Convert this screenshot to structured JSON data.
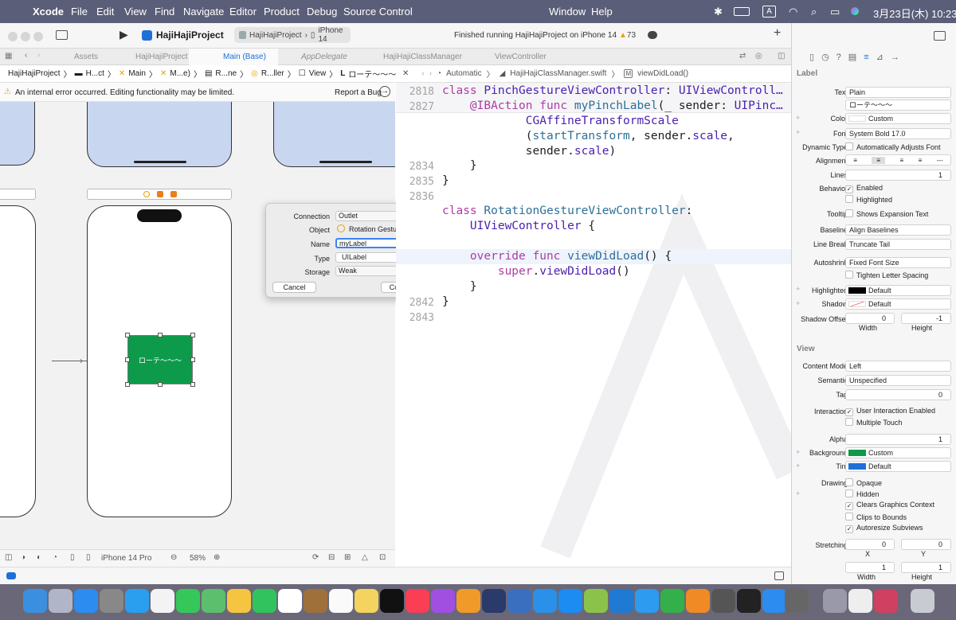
{
  "menubar": {
    "app": "Xcode",
    "items": [
      "File",
      "Edit",
      "View",
      "Find",
      "Navigate",
      "Editor",
      "Product",
      "Debug",
      "Source Control",
      "Window",
      "Help"
    ],
    "input_mode": "A",
    "clock": "3月23日(木)  10:23"
  },
  "toolbar": {
    "project": "HajiHajiProject",
    "scheme": "HajiHajiProject",
    "device": "iPhone 14",
    "status": "Finished running HajiHajiProject on iPhone 14",
    "warnings": "73"
  },
  "tabs": [
    "Assets",
    "HajiHajiProject",
    "Main (Base)",
    "AppDelegate",
    "HajiHajiClassManager",
    "ViewController"
  ],
  "jump_left": [
    "HajiHajiProject",
    "H...ct",
    "Main",
    "M...e)",
    "R...ne",
    "R...ller",
    "View",
    "ローテ〜〜〜"
  ],
  "warning": {
    "text": "An internal error occurred. Editing functionality may be limited.",
    "button": "Report a Bug"
  },
  "jump_right": [
    "Automatic",
    "HajiHajiClassManager.swift",
    "viewDidLoad()"
  ],
  "canvas": {
    "label_text": "ローテ〜〜〜",
    "device": "iPhone 14 Pro",
    "zoom": "58%"
  },
  "code_lines": [
    {
      "num": "2818",
      "text": "class PinchGestureViewController: UIViewControll…"
    },
    {
      "num": "2827",
      "text": "    @IBAction func myPinchLabel(_ sender: UIPinc…"
    },
    {
      "num": "",
      "text": "            CGAffineTransformScale"
    },
    {
      "num": "",
      "text": "            (startTransform, sender.scale,"
    },
    {
      "num": "",
      "text": "            sender.scale)"
    },
    {
      "num": "2834",
      "text": "    }"
    },
    {
      "num": "2835",
      "text": "}"
    },
    {
      "num": "2836",
      "text": ""
    },
    {
      "num": "",
      "text": "class RotationGestureViewController:"
    },
    {
      "num": "",
      "text": "    UIViewController {"
    },
    {
      "num": "",
      "text": ""
    },
    {
      "num": "",
      "text": "    override func viewDidLoad() {"
    },
    {
      "num": "",
      "text": "        super.viewDidLoad()"
    },
    {
      "num": "",
      "text": "    }"
    },
    {
      "num": "2842",
      "text": "}"
    },
    {
      "num": "2843",
      "text": ""
    }
  ],
  "popup": {
    "connection_label": "Connection",
    "connection": "Outlet",
    "object_label": "Object",
    "object": "Rotation Gesture Vie...",
    "name_label": "Name",
    "name": "myLabel",
    "type_label": "Type",
    "type": "UILabel",
    "storage_label": "Storage",
    "storage": "Weak",
    "cancel": "Cancel",
    "connect": "Connect"
  },
  "inspector": {
    "label_section": "Label",
    "text_label": "Text",
    "text_value": "Plain",
    "text_content": "ローテ〜〜〜",
    "color_label": "Color",
    "color_value": "Custom",
    "font_label": "Font",
    "font_value": "System Bold 17.0",
    "dynamic_type_label": "Dynamic Type",
    "dynamic_type_value": "Automatically Adjusts Font",
    "alignment_label": "Alignment",
    "lines_label": "Lines",
    "lines_value": "1",
    "behavior_label": "Behavior",
    "enabled": "Enabled",
    "highlighted": "Highlighted",
    "tooltip_label": "Tooltip",
    "tooltip_value": "Shows Expansion Text",
    "baseline_label": "Baseline",
    "baseline_value": "Align Baselines",
    "linebreak_label": "Line Break",
    "linebreak_value": "Truncate Tail",
    "autoshrink_label": "Autoshrink",
    "autoshrink_value": "Fixed Font Size",
    "tighten": "Tighten Letter Spacing",
    "highlighted_label": "Highlighted",
    "highlighted_value": "Default",
    "shadow_label": "Shadow",
    "shadow_value": "Default",
    "shadow_offset_label": "Shadow Offset",
    "shadow_w": "0",
    "shadow_h": "-1",
    "width": "Width",
    "height": "Height",
    "view_section": "View",
    "content_mode_label": "Content Mode",
    "content_mode_value": "Left",
    "semantic_label": "Semantic",
    "semantic_value": "Unspecified",
    "tag_label": "Tag",
    "tag_value": "0",
    "interaction_label": "Interaction",
    "user_interaction": "User Interaction Enabled",
    "multiple_touch": "Multiple Touch",
    "alpha_label": "Alpha",
    "alpha_value": "1",
    "background_label": "Background",
    "background_value": "Custom",
    "tint_label": "Tint",
    "tint_value": "Default",
    "drawing_label": "Drawing",
    "opaque": "Opaque",
    "hidden": "Hidden",
    "clears": "Clears Graphics Context",
    "clips": "Clips to Bounds",
    "autoresize": "Autoresize Subviews",
    "stretching_label": "Stretching",
    "stretch_x": "0",
    "stretch_y": "0",
    "x": "X",
    "y": "Y",
    "stretch_w": "1",
    "stretch_h": "1"
  },
  "colors": {
    "label_bg": "#0e9a4b",
    "menubar": "#5b5e78",
    "tint": "#1f6fd9"
  }
}
